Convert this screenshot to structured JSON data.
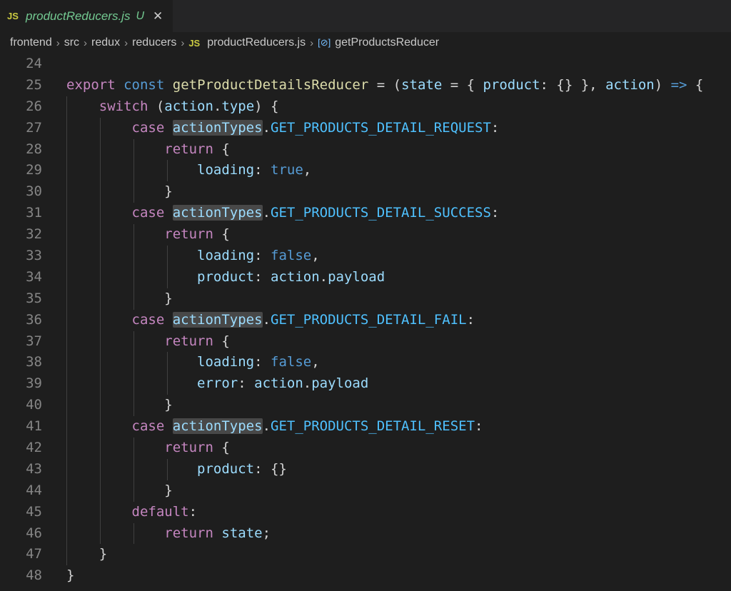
{
  "tab": {
    "badge": "JS",
    "filename": "productReducers.js",
    "status": "U",
    "close": "✕"
  },
  "breadcrumb": {
    "items": [
      "frontend",
      "src",
      "redux",
      "reducers",
      "productReducers.js",
      "getProductsReducer"
    ],
    "file_badge": "JS",
    "symbol_icon": "[⊘]"
  },
  "code": {
    "lines": [
      {
        "n": "24",
        "tokens": []
      },
      {
        "n": "25",
        "tokens": [
          [
            "kw",
            "export"
          ],
          [
            "op",
            " "
          ],
          [
            "st",
            "const"
          ],
          [
            "op",
            " "
          ],
          [
            "fn",
            "getProductDetailsReducer"
          ],
          [
            "op",
            " = ("
          ],
          [
            "var",
            "state"
          ],
          [
            "op",
            " = { "
          ],
          [
            "var",
            "product"
          ],
          [
            "op",
            ": {} }, "
          ],
          [
            "var",
            "action"
          ],
          [
            "op",
            ") "
          ],
          [
            "st",
            "=>"
          ],
          [
            "op",
            " {"
          ]
        ]
      },
      {
        "n": "26",
        "tokens": [
          [
            "op",
            "    "
          ],
          [
            "kw",
            "switch"
          ],
          [
            "op",
            " ("
          ],
          [
            "var",
            "action"
          ],
          [
            "op",
            "."
          ],
          [
            "var",
            "type"
          ],
          [
            "op",
            ") {"
          ]
        ]
      },
      {
        "n": "27",
        "tokens": [
          [
            "op",
            "        "
          ],
          [
            "kw",
            "case"
          ],
          [
            "op",
            " "
          ],
          [
            "var hl",
            "actionTypes"
          ],
          [
            "op",
            "."
          ],
          [
            "cst",
            "GET_PRODUCTS_DETAIL_REQUEST"
          ],
          [
            "op",
            ":"
          ]
        ]
      },
      {
        "n": "28",
        "tokens": [
          [
            "op",
            "            "
          ],
          [
            "kw",
            "return"
          ],
          [
            "op",
            " {"
          ]
        ]
      },
      {
        "n": "29",
        "tokens": [
          [
            "op",
            "                "
          ],
          [
            "var",
            "loading"
          ],
          [
            "op",
            ": "
          ],
          [
            "st",
            "true"
          ],
          [
            "op",
            ","
          ]
        ]
      },
      {
        "n": "30",
        "tokens": [
          [
            "op",
            "            }"
          ]
        ]
      },
      {
        "n": "31",
        "tokens": [
          [
            "op",
            "        "
          ],
          [
            "kw",
            "case"
          ],
          [
            "op",
            " "
          ],
          [
            "var hl",
            "actionTypes"
          ],
          [
            "op",
            "."
          ],
          [
            "cst",
            "GET_PRODUCTS_DETAIL_SUCCESS"
          ],
          [
            "op",
            ":"
          ]
        ]
      },
      {
        "n": "32",
        "tokens": [
          [
            "op",
            "            "
          ],
          [
            "kw",
            "return"
          ],
          [
            "op",
            " {"
          ]
        ]
      },
      {
        "n": "33",
        "tokens": [
          [
            "op",
            "                "
          ],
          [
            "var",
            "loading"
          ],
          [
            "op",
            ": "
          ],
          [
            "st",
            "false"
          ],
          [
            "op",
            ","
          ]
        ]
      },
      {
        "n": "34",
        "tokens": [
          [
            "op",
            "                "
          ],
          [
            "var",
            "product"
          ],
          [
            "op",
            ": "
          ],
          [
            "var",
            "action"
          ],
          [
            "op",
            "."
          ],
          [
            "var",
            "payload"
          ]
        ]
      },
      {
        "n": "35",
        "tokens": [
          [
            "op",
            "            }"
          ]
        ]
      },
      {
        "n": "36",
        "tokens": [
          [
            "op",
            "        "
          ],
          [
            "kw",
            "case"
          ],
          [
            "op",
            " "
          ],
          [
            "var hl",
            "actionTypes"
          ],
          [
            "op",
            "."
          ],
          [
            "cst",
            "GET_PRODUCTS_DETAIL_FAIL"
          ],
          [
            "op",
            ":"
          ]
        ]
      },
      {
        "n": "37",
        "tokens": [
          [
            "op",
            "            "
          ],
          [
            "kw",
            "return"
          ],
          [
            "op",
            " {"
          ]
        ]
      },
      {
        "n": "38",
        "tokens": [
          [
            "op",
            "                "
          ],
          [
            "var",
            "loading"
          ],
          [
            "op",
            ": "
          ],
          [
            "st",
            "false"
          ],
          [
            "op",
            ","
          ]
        ]
      },
      {
        "n": "39",
        "tokens": [
          [
            "op",
            "                "
          ],
          [
            "var",
            "error"
          ],
          [
            "op",
            ": "
          ],
          [
            "var",
            "action"
          ],
          [
            "op",
            "."
          ],
          [
            "var",
            "payload"
          ]
        ]
      },
      {
        "n": "40",
        "tokens": [
          [
            "op",
            "            }"
          ]
        ]
      },
      {
        "n": "41",
        "tokens": [
          [
            "op",
            "        "
          ],
          [
            "kw",
            "case"
          ],
          [
            "op",
            " "
          ],
          [
            "var hl",
            "actionTypes"
          ],
          [
            "op",
            "."
          ],
          [
            "cst",
            "GET_PRODUCTS_DETAIL_RESET"
          ],
          [
            "op",
            ":"
          ]
        ]
      },
      {
        "n": "42",
        "tokens": [
          [
            "op",
            "            "
          ],
          [
            "kw",
            "return"
          ],
          [
            "op",
            " {"
          ]
        ]
      },
      {
        "n": "43",
        "tokens": [
          [
            "op",
            "                "
          ],
          [
            "var",
            "product"
          ],
          [
            "op",
            ": {}"
          ]
        ]
      },
      {
        "n": "44",
        "tokens": [
          [
            "op",
            "            }"
          ]
        ]
      },
      {
        "n": "45",
        "tokens": [
          [
            "op",
            "        "
          ],
          [
            "kw",
            "default"
          ],
          [
            "op",
            ":"
          ]
        ]
      },
      {
        "n": "46",
        "tokens": [
          [
            "op",
            "            "
          ],
          [
            "kw",
            "return"
          ],
          [
            "op",
            " "
          ],
          [
            "var",
            "state"
          ],
          [
            "op",
            ";"
          ]
        ]
      },
      {
        "n": "47",
        "tokens": [
          [
            "op",
            "    }"
          ]
        ]
      },
      {
        "n": "48",
        "tokens": [
          [
            "op",
            "}"
          ]
        ]
      }
    ]
  }
}
